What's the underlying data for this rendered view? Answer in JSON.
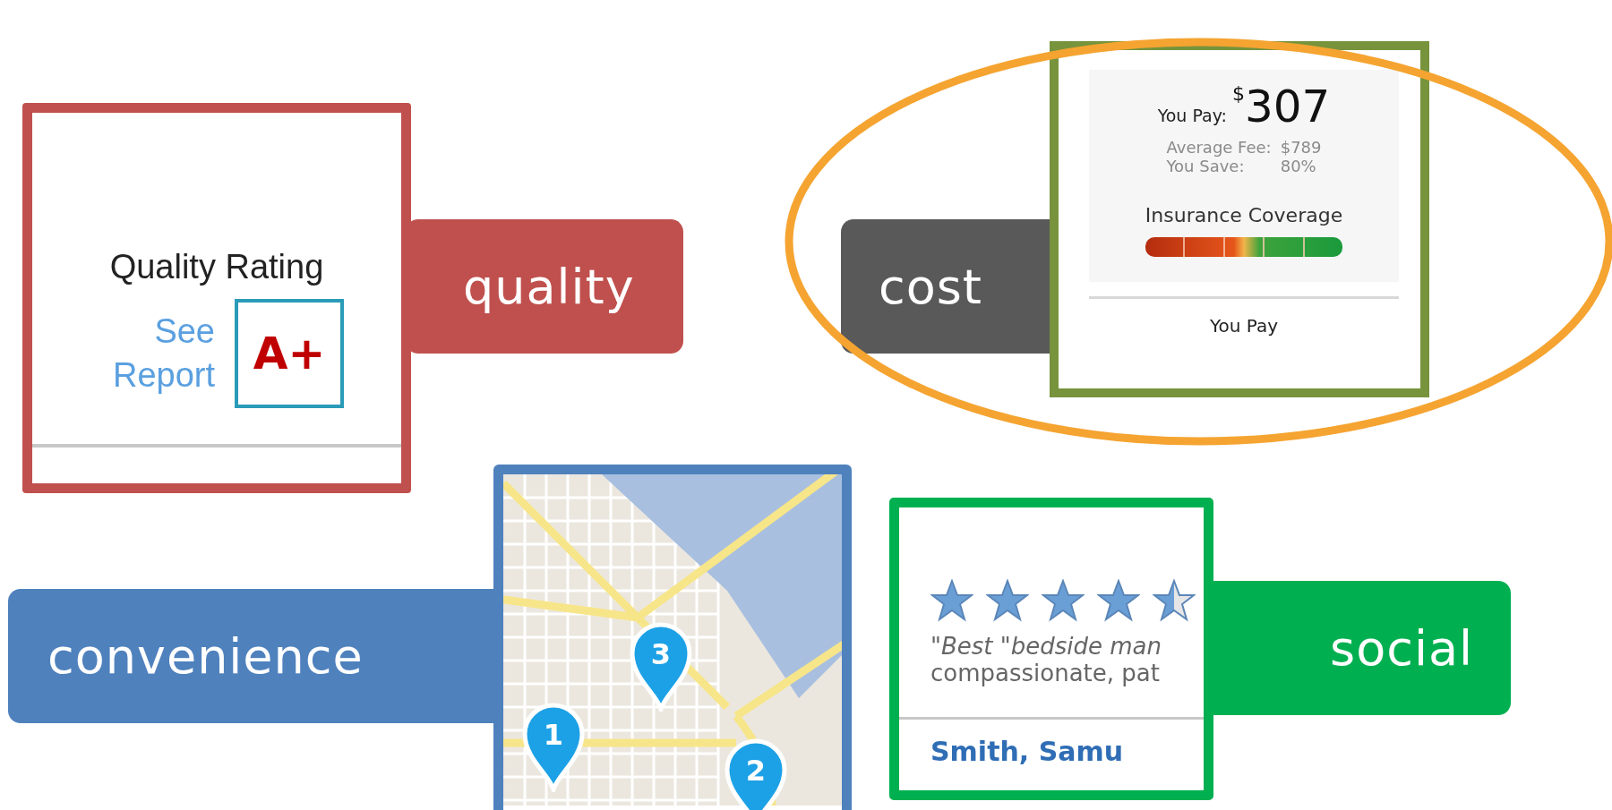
{
  "quality": {
    "tag": "quality",
    "heading": "Quality Rating",
    "link": "See Report",
    "grade": "A+"
  },
  "cost": {
    "tag": "cost",
    "pay_label": "You Pay:",
    "currency": "$",
    "amount": "307",
    "average_fee_label": "Average Fee:",
    "average_fee": "$789",
    "savings_label": "You Save:",
    "savings": "80%",
    "coverage_heading": "Insurance Coverage",
    "next_pay_label": "You Pay"
  },
  "convenience": {
    "tag": "convenience",
    "pins": [
      {
        "number": "3"
      },
      {
        "number": "1"
      },
      {
        "number": "2"
      }
    ]
  },
  "social": {
    "tag": "social",
    "stars": 4.5,
    "review_lines": [
      "\"Best \"bedside man",
      "compassionate, pat"
    ],
    "doctor_name": "Smith, Samu"
  }
}
